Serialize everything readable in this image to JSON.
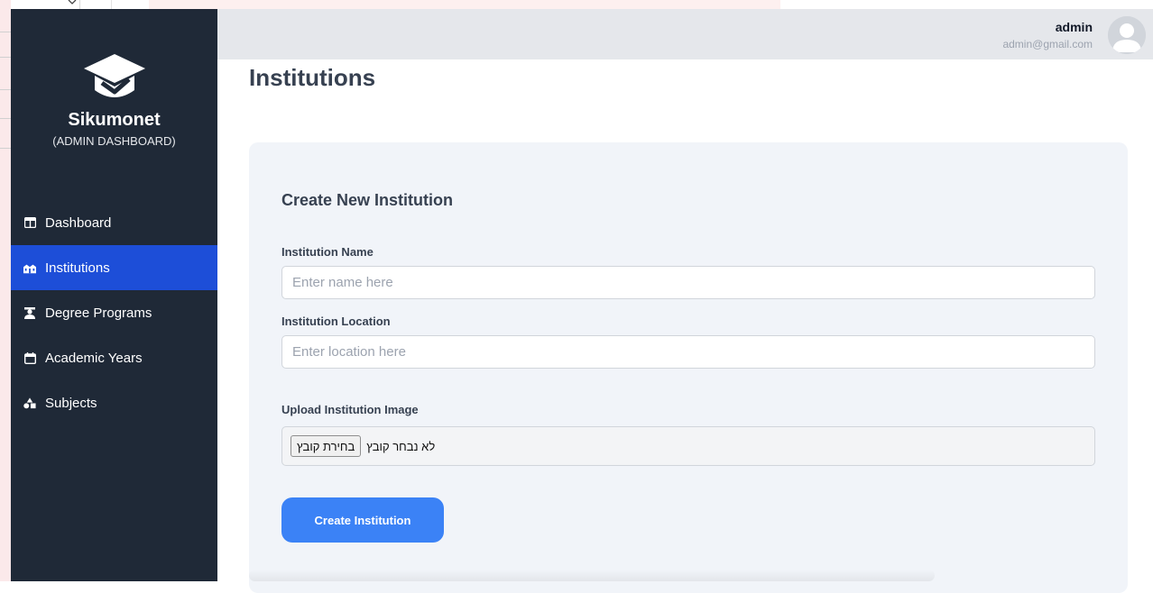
{
  "sidebar": {
    "brand_name": "Sikumonet",
    "brand_sub": "(ADMIN DASHBOARD)",
    "items": [
      {
        "label": "Dashboard",
        "icon": "table-icon"
      },
      {
        "label": "Institutions",
        "icon": "building-icon",
        "active": true
      },
      {
        "label": "Degree Programs",
        "icon": "graduate-icon"
      },
      {
        "label": "Academic Years",
        "icon": "calendar-icon"
      },
      {
        "label": "Subjects",
        "icon": "shapes-icon"
      }
    ]
  },
  "header": {
    "user_name": "admin",
    "user_email": "admin@gmail.com"
  },
  "page": {
    "title": "Institutions"
  },
  "form": {
    "title": "Create New Institution",
    "name_label": "Institution Name",
    "name_placeholder": "Enter name here",
    "name_value": "",
    "location_label": "Institution Location",
    "location_placeholder": "Enter location here",
    "location_value": "",
    "image_label": "Upload Institution Image",
    "file_button": "בחירת קובץ",
    "file_status": "לא נבחר קובץ",
    "submit_label": "Create Institution"
  },
  "colors": {
    "sidebar_bg": "#1f2937",
    "active_item": "#1d4ed8",
    "primary_button": "#3b82f6",
    "card_bg": "#f1f4f9",
    "topbar_bg": "#e5e7eb"
  }
}
